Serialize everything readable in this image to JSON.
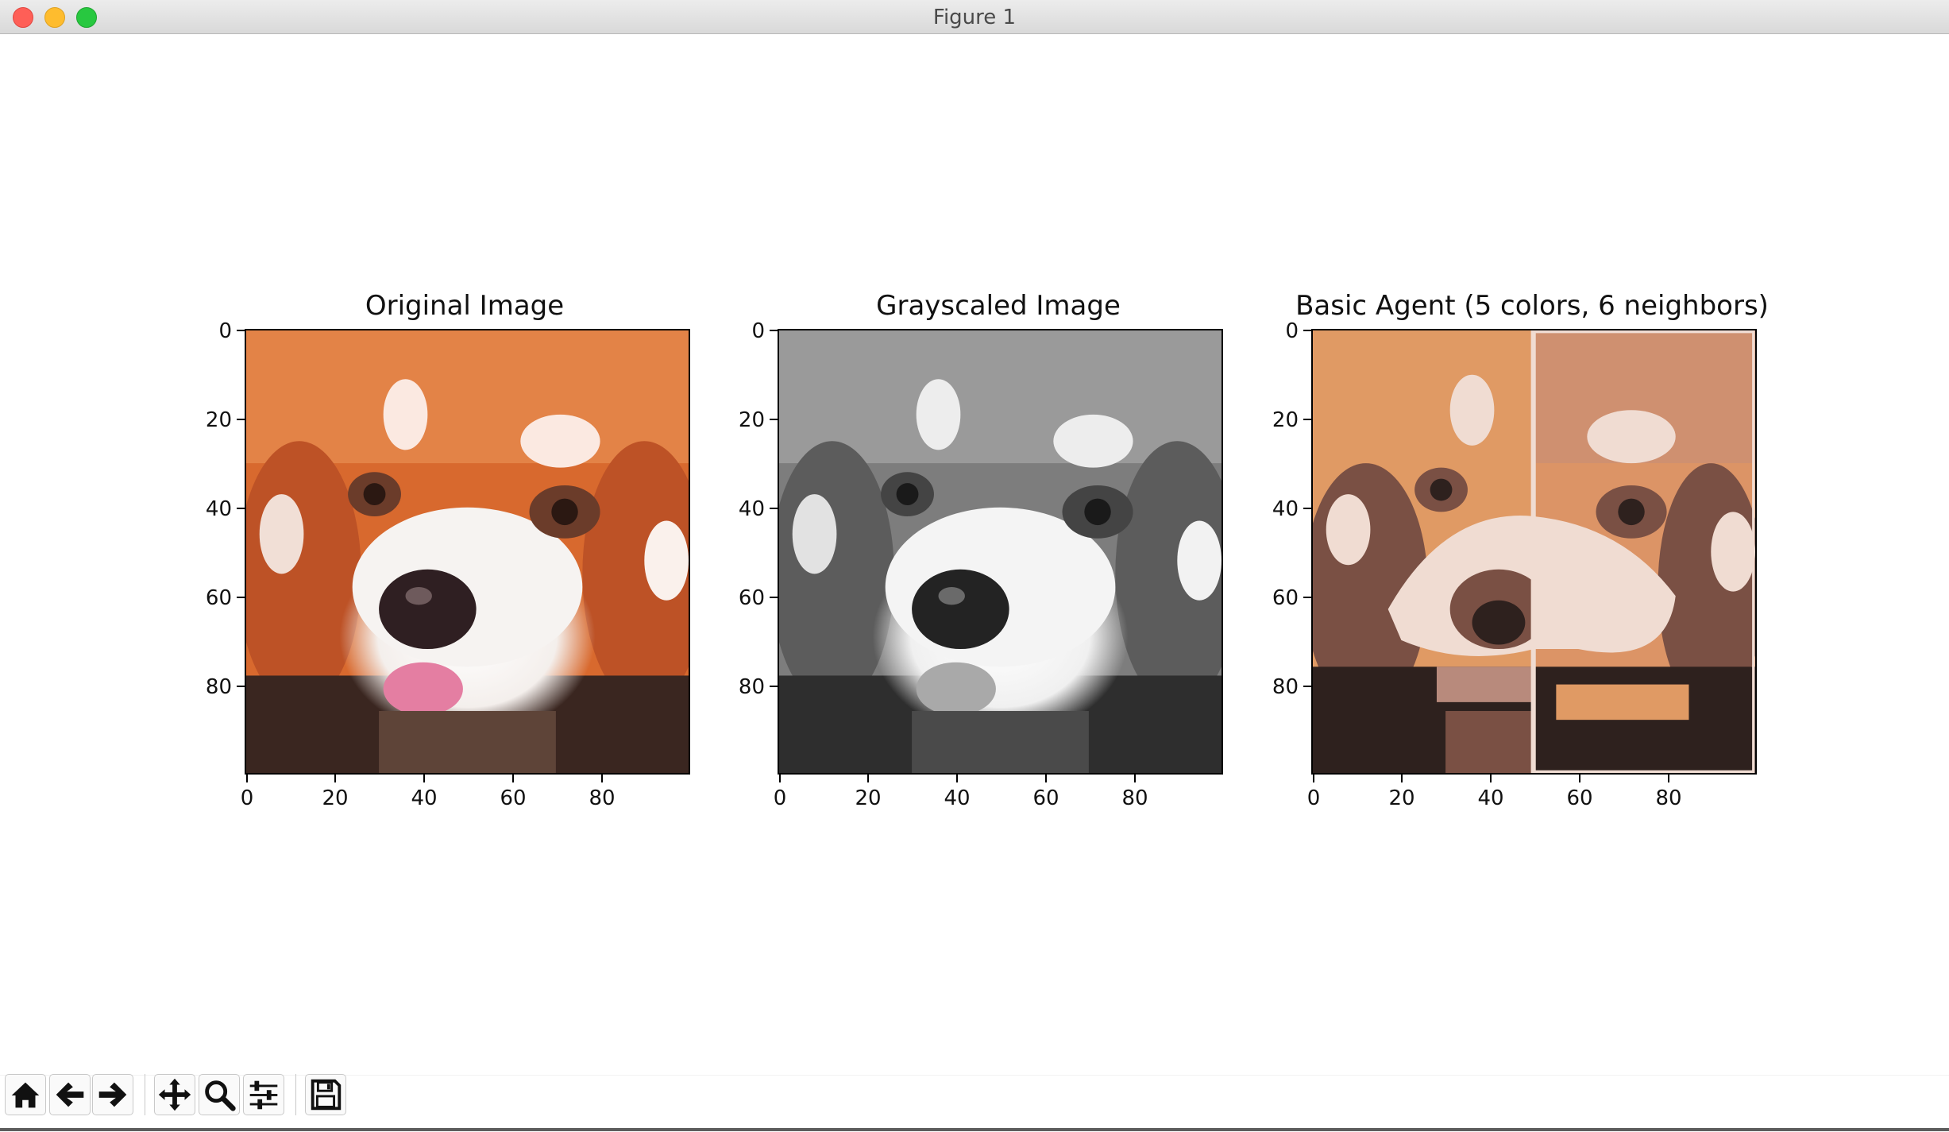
{
  "window": {
    "title": "Figure 1"
  },
  "traffic_lights": [
    {
      "name": "close",
      "color": "#fe5f57"
    },
    {
      "name": "minimize",
      "color": "#febc2e"
    },
    {
      "name": "maximize",
      "color": "#28c840"
    }
  ],
  "figure": {
    "panels": [
      {
        "title": "Original Image",
        "image": "red-panda-color",
        "xticks": [
          "0",
          "20",
          "40",
          "60",
          "80"
        ],
        "yticks": [
          "0",
          "20",
          "40",
          "60",
          "80"
        ]
      },
      {
        "title": "Grayscaled Image",
        "image": "red-panda-grayscale",
        "xticks": [
          "0",
          "20",
          "40",
          "60",
          "80"
        ],
        "yticks": [
          "0",
          "20",
          "40",
          "60",
          "80"
        ]
      },
      {
        "title": "Basic Agent (5 colors, 6 neighbors)",
        "image": "red-panda-5-color-recolor",
        "xticks": [
          "0",
          "20",
          "40",
          "60",
          "80"
        ],
        "yticks": [
          "0",
          "20",
          "40",
          "60",
          "80"
        ]
      }
    ],
    "axis_range": [
      0,
      100
    ],
    "palette_5_colors": [
      "#e09a64",
      "#f0dcd2",
      "#b88a7c",
      "#7a5044",
      "#2e211e"
    ]
  },
  "toolbar": {
    "buttons": [
      {
        "name": "home-button",
        "icon": "home-icon"
      },
      {
        "name": "back-button",
        "icon": "arrow-left-icon"
      },
      {
        "name": "forward-button",
        "icon": "arrow-right-icon"
      },
      {
        "name": "pan-button",
        "icon": "move-icon"
      },
      {
        "name": "zoom-button",
        "icon": "magnifier-icon"
      },
      {
        "name": "configure-subplots-button",
        "icon": "sliders-icon"
      },
      {
        "name": "save-button",
        "icon": "floppy-disk-icon"
      }
    ]
  }
}
